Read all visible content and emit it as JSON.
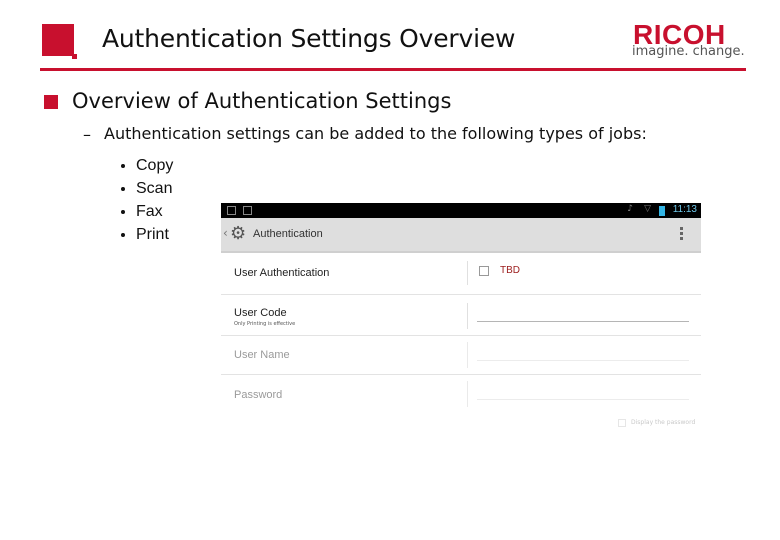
{
  "slide": {
    "title": "Authentication Settings Overview",
    "logo": {
      "brand": "RICOH",
      "tagline": "imagine. change."
    },
    "heading": "Overview of Authentication Settings",
    "dash": "–",
    "subline": "Authentication settings can be added to the following types of jobs:",
    "jobs": [
      "Copy",
      "Scan",
      "Fax",
      "Print"
    ],
    "colors": {
      "accent": "#c8102e"
    }
  },
  "device": {
    "statusbar": {
      "time": "11:13",
      "icons": [
        "gallery-icon",
        "sd-card-icon",
        "mute-icon",
        "wifi-icon",
        "battery-icon"
      ]
    },
    "actionbar": {
      "title": "Authentication",
      "back": "‹",
      "gear": "⚙"
    },
    "rows": [
      {
        "label": "User Authentication",
        "checkbox_label": "TBD",
        "checked": false
      },
      {
        "label": "User Code",
        "sublabel": "Only Printing is effective"
      },
      {
        "label": "User Name"
      },
      {
        "label": "Password"
      }
    ],
    "show_password": "Display the password"
  }
}
